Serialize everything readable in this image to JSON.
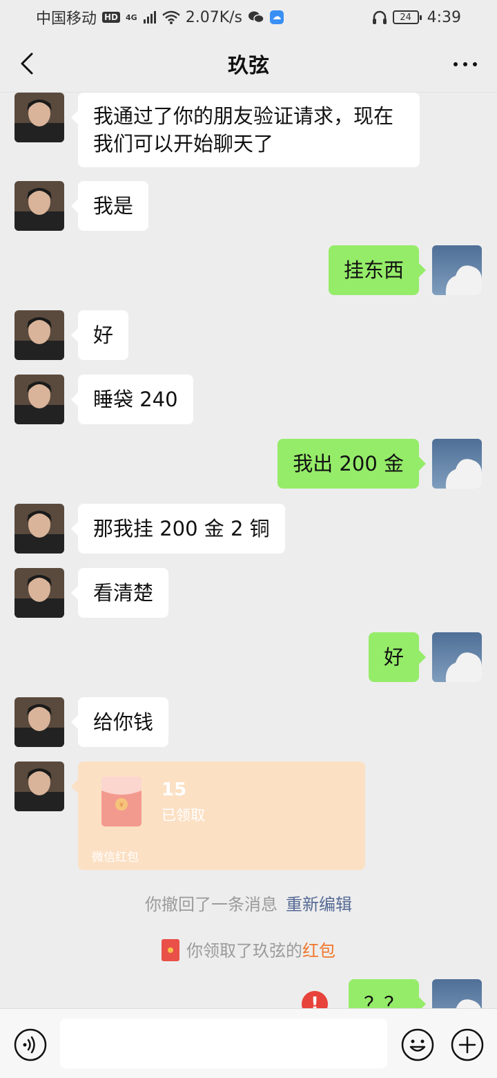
{
  "status_bar": {
    "carrier": "中国移动",
    "hd": "HD",
    "network": "4G",
    "speed": "2.07K/s",
    "battery": "24",
    "time": "4:39"
  },
  "header": {
    "title": "玖弦"
  },
  "messages": [
    {
      "sender": "other",
      "text": "我通过了你的朋友验证请求，现在我们可以开始聊天了"
    },
    {
      "sender": "other",
      "text": "我是"
    },
    {
      "sender": "self",
      "text": "挂东西"
    },
    {
      "sender": "other",
      "text": "好"
    },
    {
      "sender": "other",
      "text": "睡袋 240"
    },
    {
      "sender": "self",
      "text": "我出 200 金"
    },
    {
      "sender": "other",
      "text": "那我挂 200 金 2 铜"
    },
    {
      "sender": "other",
      "text": "看清楚"
    },
    {
      "sender": "self",
      "text": "好"
    },
    {
      "sender": "other",
      "text": "给你钱"
    },
    {
      "sender": "self",
      "text": "？？",
      "failed": true
    }
  ],
  "red_packet": {
    "amount": "15",
    "status": "已领取",
    "footer": "微信红包"
  },
  "notices": {
    "recall": "你撤回了一条消息",
    "reedit": "重新编辑",
    "received_prefix": "你领取了玖弦的",
    "received_link": "红包"
  },
  "input": {
    "placeholder": ""
  },
  "colors": {
    "background": "#ededed",
    "bubble_in": "#ffffff",
    "bubble_out": "#95ec69",
    "red_packet": "#fce0c4",
    "link": "#576b95",
    "accent_red": "#e8433b"
  },
  "icons": [
    "back-icon",
    "more-icon",
    "voice-icon",
    "emoji-icon",
    "plus-icon",
    "wifi-icon",
    "signal-icon",
    "headphones-icon",
    "wechat-icon"
  ]
}
